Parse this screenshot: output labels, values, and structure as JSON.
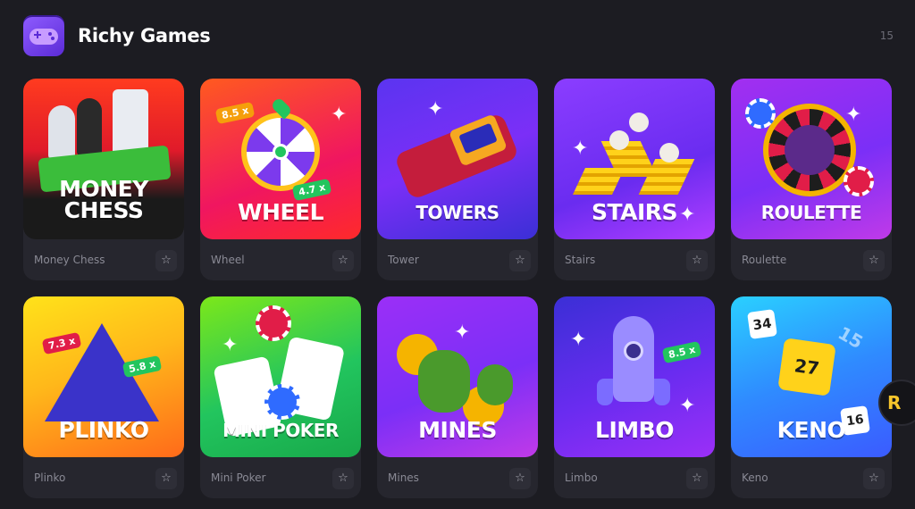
{
  "header": {
    "title": "Richy Games",
    "count": "15"
  },
  "games": [
    {
      "label": "Money Chess",
      "art_line1": "MONEY",
      "art_line2": "CHESS"
    },
    {
      "label": "Wheel",
      "art_line1": "WHEEL",
      "tags": [
        "8.5 x",
        "4.7 x"
      ]
    },
    {
      "label": "Tower",
      "art_line1": "TOWERS"
    },
    {
      "label": "Stairs",
      "art_line1": "STAIRS"
    },
    {
      "label": "Roulette",
      "art_line1": "ROULETTE"
    },
    {
      "label": "Plinko",
      "art_line1": "PLINKO",
      "tags": [
        "7.3 x",
        "5.8 x"
      ]
    },
    {
      "label": "Mini Poker",
      "art_line1": "MINI POKER"
    },
    {
      "label": "Mines",
      "art_line1": "MINES"
    },
    {
      "label": "Limbo",
      "art_line1": "LIMBO",
      "tags": [
        "8.5 x"
      ]
    },
    {
      "label": "Keno",
      "art_line1": "KENO",
      "numbers": [
        "34",
        "27",
        "16",
        "15"
      ]
    }
  ],
  "icons": {
    "favorite": "star-outline-icon",
    "logo": "gamepad-icon"
  },
  "side_avatar_letter": "R"
}
